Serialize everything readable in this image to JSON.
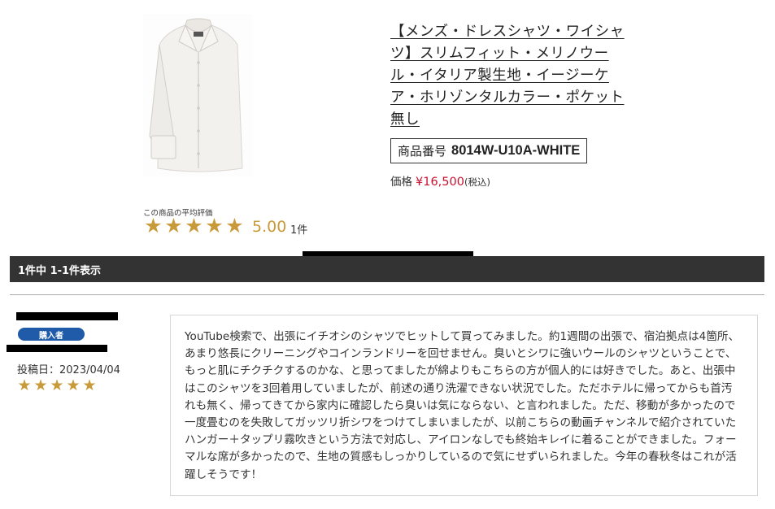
{
  "product": {
    "title": "【メンズ・ドレスシャツ・ワイシャツ】スリムフィット・メリノウール・イタリア製生地・イージーケア・ホリゾンタルカラー・ポケット無し",
    "image_alt": "white dress shirt",
    "sku_label": "商品番号",
    "sku": "8014W-U10A-WHITE",
    "price_label": "価格",
    "price": "¥16,500",
    "price_tax": "(税込)"
  },
  "rating_summary": {
    "label": "この商品の平均評価",
    "stars": 5,
    "score": "5.00",
    "count": "1件"
  },
  "results": {
    "text": "1件中 1-1件表示"
  },
  "review": {
    "buyer_badge": "購入者",
    "date": "投稿日：2023/04/04",
    "stars": 5,
    "text": "YouTube検索で、出張にイチオシのシャツでヒットして買ってみました。約1週間の出張で、宿泊拠点は4箇所、あまり悠長にクリーニングやコインランドリーを回せません。臭いとシワに強いウールのシャツということで、もっと肌にチクチクするのかな、と思ってましたが綿よりもこちらの方が個人的には好きでした。あと、出張中はこのシャツを3回着用していましたが、前述の通り洗濯できない状況でした。ただホテルに帰ってからも首汚れも無く、帰ってきてから家内に確認したら臭いは気にならない、と言われました。ただ、移動が多かったので一度畳むのを失敗してガッツリ折シワをつけてしまいましたが、以前こちらの動画チャンネルで紹介されていたハンガー＋タップリ霧吹きという方法で対応し、アイロンなしでも終始キレイに着ることができました。フォーマルな席が多かったので、生地の質感もしっかりしているので気にせずいられました。今年の春秋冬はこれが活躍しそうです！"
  },
  "colors": {
    "star": "#c99a3a",
    "price": "#c8102e",
    "bar": "#333333",
    "badge": "#1f5ba8"
  }
}
